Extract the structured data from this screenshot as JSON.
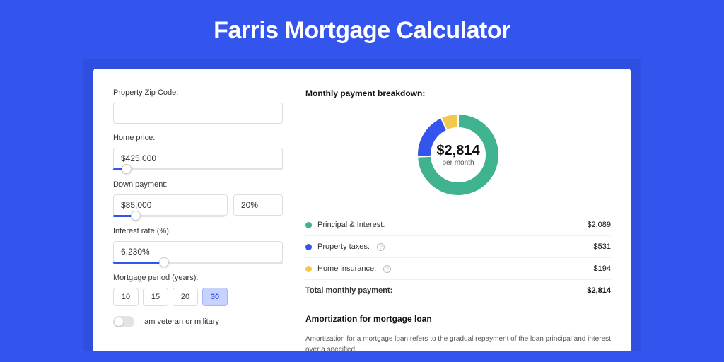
{
  "title": "Farris Mortgage Calculator",
  "form": {
    "zip_label": "Property Zip Code:",
    "zip_value": "",
    "home_price_label": "Home price:",
    "home_price_value": "$425,000",
    "home_price_slider_pct": 8,
    "down_payment_label": "Down payment:",
    "down_payment_value": "$85,000",
    "down_payment_pct_value": "20%",
    "down_payment_slider_pct": 20,
    "interest_label": "Interest rate (%):",
    "interest_value": "6.230%",
    "interest_slider_pct": 30,
    "period_label": "Mortgage period (years):",
    "periods": [
      "10",
      "15",
      "20",
      "30"
    ],
    "period_selected": "30",
    "veteran_label": "I am veteran or military"
  },
  "breakdown": {
    "heading": "Monthly payment breakdown:",
    "center_amount": "$2,814",
    "center_label": "per month",
    "items": [
      {
        "label": "Principal & Interest:",
        "value": "$2,089",
        "color": "green",
        "info": false
      },
      {
        "label": "Property taxes:",
        "value": "$531",
        "color": "blue",
        "info": true
      },
      {
        "label": "Home insurance:",
        "value": "$194",
        "color": "yellow",
        "info": true
      }
    ],
    "total_label": "Total monthly payment:",
    "total_value": "$2,814"
  },
  "chart_data": {
    "type": "pie",
    "title": "Monthly payment breakdown",
    "series": [
      {
        "name": "Principal & Interest",
        "value": 2089,
        "color": "#3fb28f"
      },
      {
        "name": "Property taxes",
        "value": 531,
        "color": "#3355ee"
      },
      {
        "name": "Home insurance",
        "value": 194,
        "color": "#f2c94c"
      }
    ],
    "total": 2814,
    "center_label": "per month"
  },
  "amortization": {
    "heading": "Amortization for mortgage loan",
    "text": "Amortization for a mortgage loan refers to the gradual repayment of the loan principal and interest over a specified"
  }
}
